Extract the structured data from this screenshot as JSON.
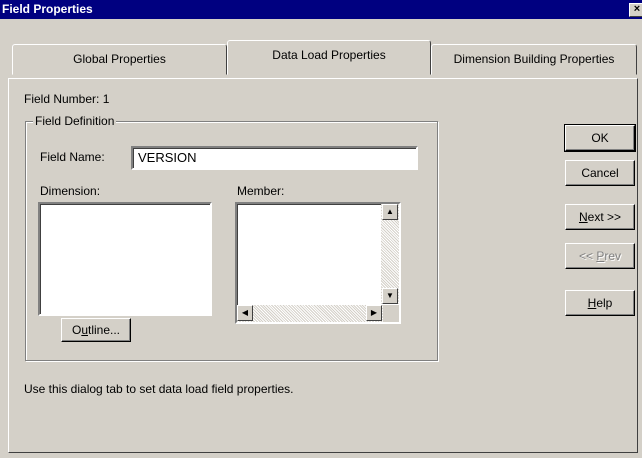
{
  "window": {
    "title": "Field Properties",
    "close_glyph": "×"
  },
  "tabs": [
    {
      "label": "Global Properties"
    },
    {
      "label": "Data Load Properties",
      "active": true
    },
    {
      "label": "Dimension Building Properties"
    }
  ],
  "field_number": {
    "label": "Field Number:",
    "value": "1"
  },
  "field_definition": {
    "legend": "Field Definition",
    "field_name_label": "Field Name:",
    "field_name_value": "VERSION",
    "dimension_label": "Dimension:",
    "member_label": "Member:",
    "outline_button": {
      "before": "O",
      "mnemonic": "u",
      "after": "tline..."
    }
  },
  "buttons": {
    "ok": "OK",
    "cancel": "Cancel",
    "next": {
      "mnemonic": "N",
      "after": "ext >>"
    },
    "prev": {
      "before": "<< ",
      "mnemonic": "P",
      "after": "rev"
    },
    "help": {
      "mnemonic": "H",
      "after": "elp"
    }
  },
  "hint": "Use this dialog tab to set data load field properties.",
  "icons": {
    "scroll_up": "▲",
    "scroll_down": "▼",
    "scroll_left": "◀",
    "scroll_right": "▶"
  },
  "colors": {
    "titlebar": "#000080",
    "face": "#d4d0c8",
    "disabled_text": "#808080"
  }
}
